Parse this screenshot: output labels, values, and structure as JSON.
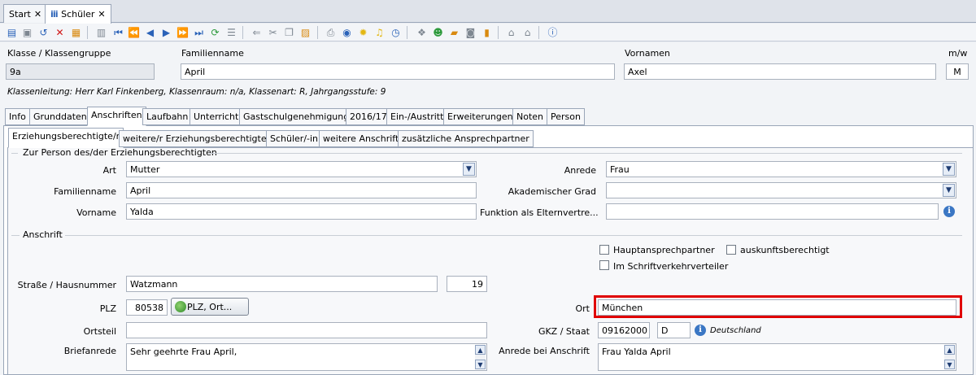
{
  "window_tabs": [
    {
      "label": "Start"
    },
    {
      "label": "Schüler"
    }
  ],
  "toolbar": {
    "icons": [
      "new-record-icon",
      "save-icon",
      "undo-icon",
      "delete-icon",
      "print-preview-icon",
      "copy-icon",
      "first-record-icon",
      "previous-page-icon",
      "previous-record-icon",
      "next-record-icon",
      "next-page-icon",
      "last-record-icon",
      "refresh-icon",
      "list-icon",
      "back-arrow-icon",
      "cut-icon",
      "copy-clipboard-icon",
      "paste-icon",
      "printer-icon",
      "view-icon",
      "idea-icon",
      "bell-icon",
      "clock-icon",
      "package-icon",
      "user-icon",
      "folder-arrow-icon",
      "database-icon",
      "document-icon",
      "home-icon",
      "home-alt-icon",
      "help-icon"
    ]
  },
  "header": {
    "klasse_label": "Klasse / Klassengruppe",
    "klasse_value": "9a",
    "familienname_label": "Familienname",
    "familienname_value": "April",
    "vornamen_label": "Vornamen",
    "vornamen_value": "Axel",
    "mw_label": "m/w",
    "mw_value": "M",
    "klassenleitung": "Klassenleitung: Herr Karl Finkenberg, Klassenraum: n/a, Klassenart: R, Jahrgangsstufe: 9"
  },
  "main_tabs": [
    "Info",
    "Grunddaten",
    "Anschriften",
    "Laufbahn",
    "Unterricht",
    "Gastschulgenehmigung",
    "2016/17",
    "Ein-/Austritt",
    "Erweiterungen",
    "Noten",
    "Person"
  ],
  "sub_tabs": [
    "Erziehungsberechtigte/r",
    "weitere/r Erziehungsberechtigte/r",
    "Schüler/-in",
    "weitere Anschrift",
    "zusätzliche Ansprechpartner"
  ],
  "person_group": {
    "title": "Zur Person des/der Erziehungsberechtigten",
    "art_label": "Art",
    "art_value": "Mutter",
    "familienname_label": "Familienname",
    "familienname_value": "April",
    "vorname_label": "Vorname",
    "vorname_value": "Yalda",
    "anrede_label": "Anrede",
    "anrede_value": "Frau",
    "akad_grad_label": "Akademischer Grad",
    "akad_grad_value": "",
    "funktion_label": "Funktion als Elternvertre...",
    "funktion_value": ""
  },
  "address_group": {
    "title": "Anschrift",
    "hauptansprechpartner": "Hauptansprechpartner",
    "auskunftsberechtigt": "auskunftsberechtigt",
    "schriftverkehr": "Im Schriftverkehrverteiler",
    "strasse_label": "Straße / Hausnummer",
    "strasse_value": "Watzmann",
    "hausnummer_value": "19",
    "plz_label": "PLZ",
    "plz_value": "80538",
    "plz_button": "PLZ, Ort...",
    "ort_label": "Ort",
    "ort_value": "München",
    "ortsteil_label": "Ortsteil",
    "ortsteil_value": "",
    "gkz_label": "GKZ / Staat",
    "gkz_value": "09162000",
    "staat_value": "D",
    "staat_name": "Deutschland",
    "briefanrede_label": "Briefanrede",
    "briefanrede_value": "Sehr geehrte Frau April,",
    "anrede_anschrift_label": "Anrede bei Anschrift",
    "anrede_anschrift_value": "Frau Yalda April"
  }
}
